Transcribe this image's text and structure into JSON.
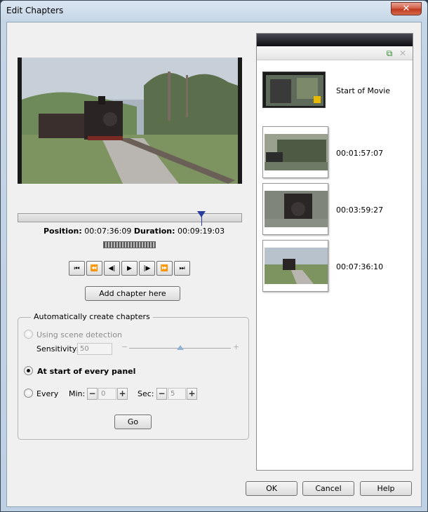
{
  "window": {
    "title": "Edit Chapters",
    "close_glyph": "✕"
  },
  "player": {
    "position_label": "Position:",
    "position_value": "00:07:36:09",
    "duration_label": "Duration:",
    "duration_value": "00:09:19:03",
    "timeline_progress": 0.815,
    "transport": [
      {
        "name": "go-to-start",
        "glyph": "⏮"
      },
      {
        "name": "fast-rewind",
        "glyph": "⏪"
      },
      {
        "name": "step-back",
        "glyph": "◀︎|"
      },
      {
        "name": "play",
        "glyph": "▶"
      },
      {
        "name": "step-forward",
        "glyph": "|▶︎"
      },
      {
        "name": "fast-forward",
        "glyph": "⏩"
      },
      {
        "name": "go-to-end",
        "glyph": "⏭"
      }
    ]
  },
  "add_chapter_label": "Add chapter here",
  "auto": {
    "group_label": "Automatically create chapters",
    "scene_detection_label": "Using scene detection",
    "sensitivity_label": "Sensitivity:",
    "sensitivity_value": "50",
    "every_panel_label": "At start of every panel",
    "every_label": "Every",
    "min_label": "Min:",
    "min_value": "0",
    "sec_label": "Sec:",
    "sec_value": "5",
    "go_label": "Go",
    "selected": "every-panel"
  },
  "chapters": [
    {
      "label": "Start of Movie",
      "locked": true
    },
    {
      "label": "00:01:57:07"
    },
    {
      "label": "00:03:59:27"
    },
    {
      "label": "00:07:36:10"
    }
  ],
  "footer": {
    "ok_label": "OK",
    "cancel_label": "Cancel",
    "help_label": "Help"
  }
}
